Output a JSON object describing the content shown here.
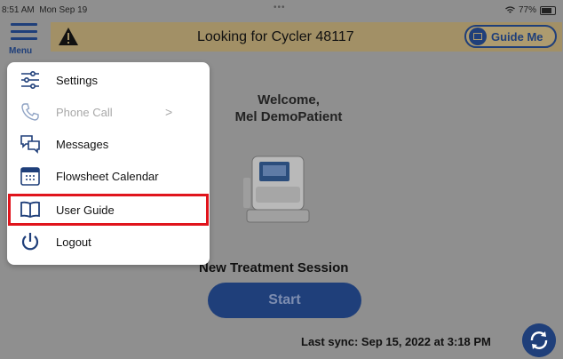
{
  "status_bar": {
    "time": "8:51 AM",
    "date": "Mon Sep 19",
    "dots": "•••",
    "battery": "77%"
  },
  "header": {
    "menu_label": "Menu",
    "message": "Looking for Cycler 48117",
    "guide_me_label": "Guide Me"
  },
  "main": {
    "welcome_line1": "Welcome,",
    "welcome_line2": "Mel DemoPatient",
    "session_title": "New Treatment Session",
    "start_label": "Start",
    "last_sync": "Last sync: Sep 15, 2022 at 3:18 PM"
  },
  "menu": {
    "items": [
      {
        "label": "Settings",
        "icon": "sliders-icon"
      },
      {
        "label": "Phone Call",
        "icon": "phone-icon",
        "disabled": true
      },
      {
        "label": "Messages",
        "icon": "chat-bubbles-icon"
      },
      {
        "label": "Flowsheet Calendar",
        "icon": "calendar-icon"
      },
      {
        "label": "User Guide",
        "icon": "book-icon"
      },
      {
        "label": "Logout",
        "icon": "power-icon"
      }
    ]
  },
  "colors": {
    "accent": "#1f3f7a",
    "banner": "#a29066",
    "overlay_bg": "#8f8f8f",
    "highlight": "#e0141c"
  }
}
